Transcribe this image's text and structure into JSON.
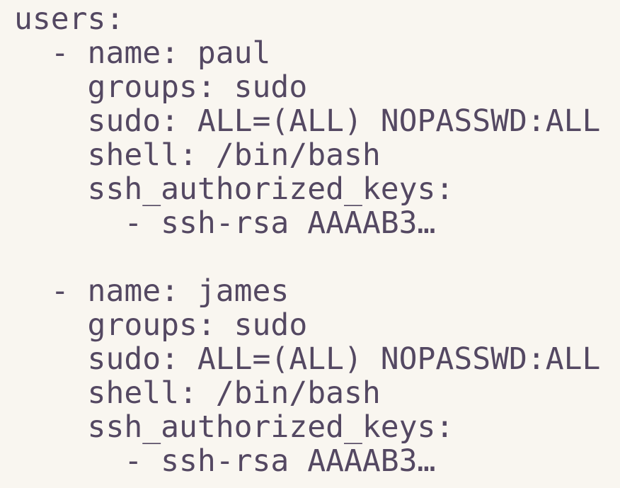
{
  "code": {
    "lines": [
      "users:",
      "  - name: paul",
      "    groups: sudo",
      "    sudo: ALL=(ALL) NOPASSWD:ALL",
      "    shell: /bin/bash",
      "    ssh_authorized_keys:",
      "      - ssh-rsa AAAAB3…",
      "",
      "  - name: james",
      "    groups: sudo",
      "    sudo: ALL=(ALL) NOPASSWD:ALL",
      "    shell: /bin/bash",
      "    ssh_authorized_keys:",
      "      - ssh-rsa AAAAB3…"
    ]
  },
  "colors": {
    "background": "#f9f6f0",
    "text": "#544862"
  }
}
